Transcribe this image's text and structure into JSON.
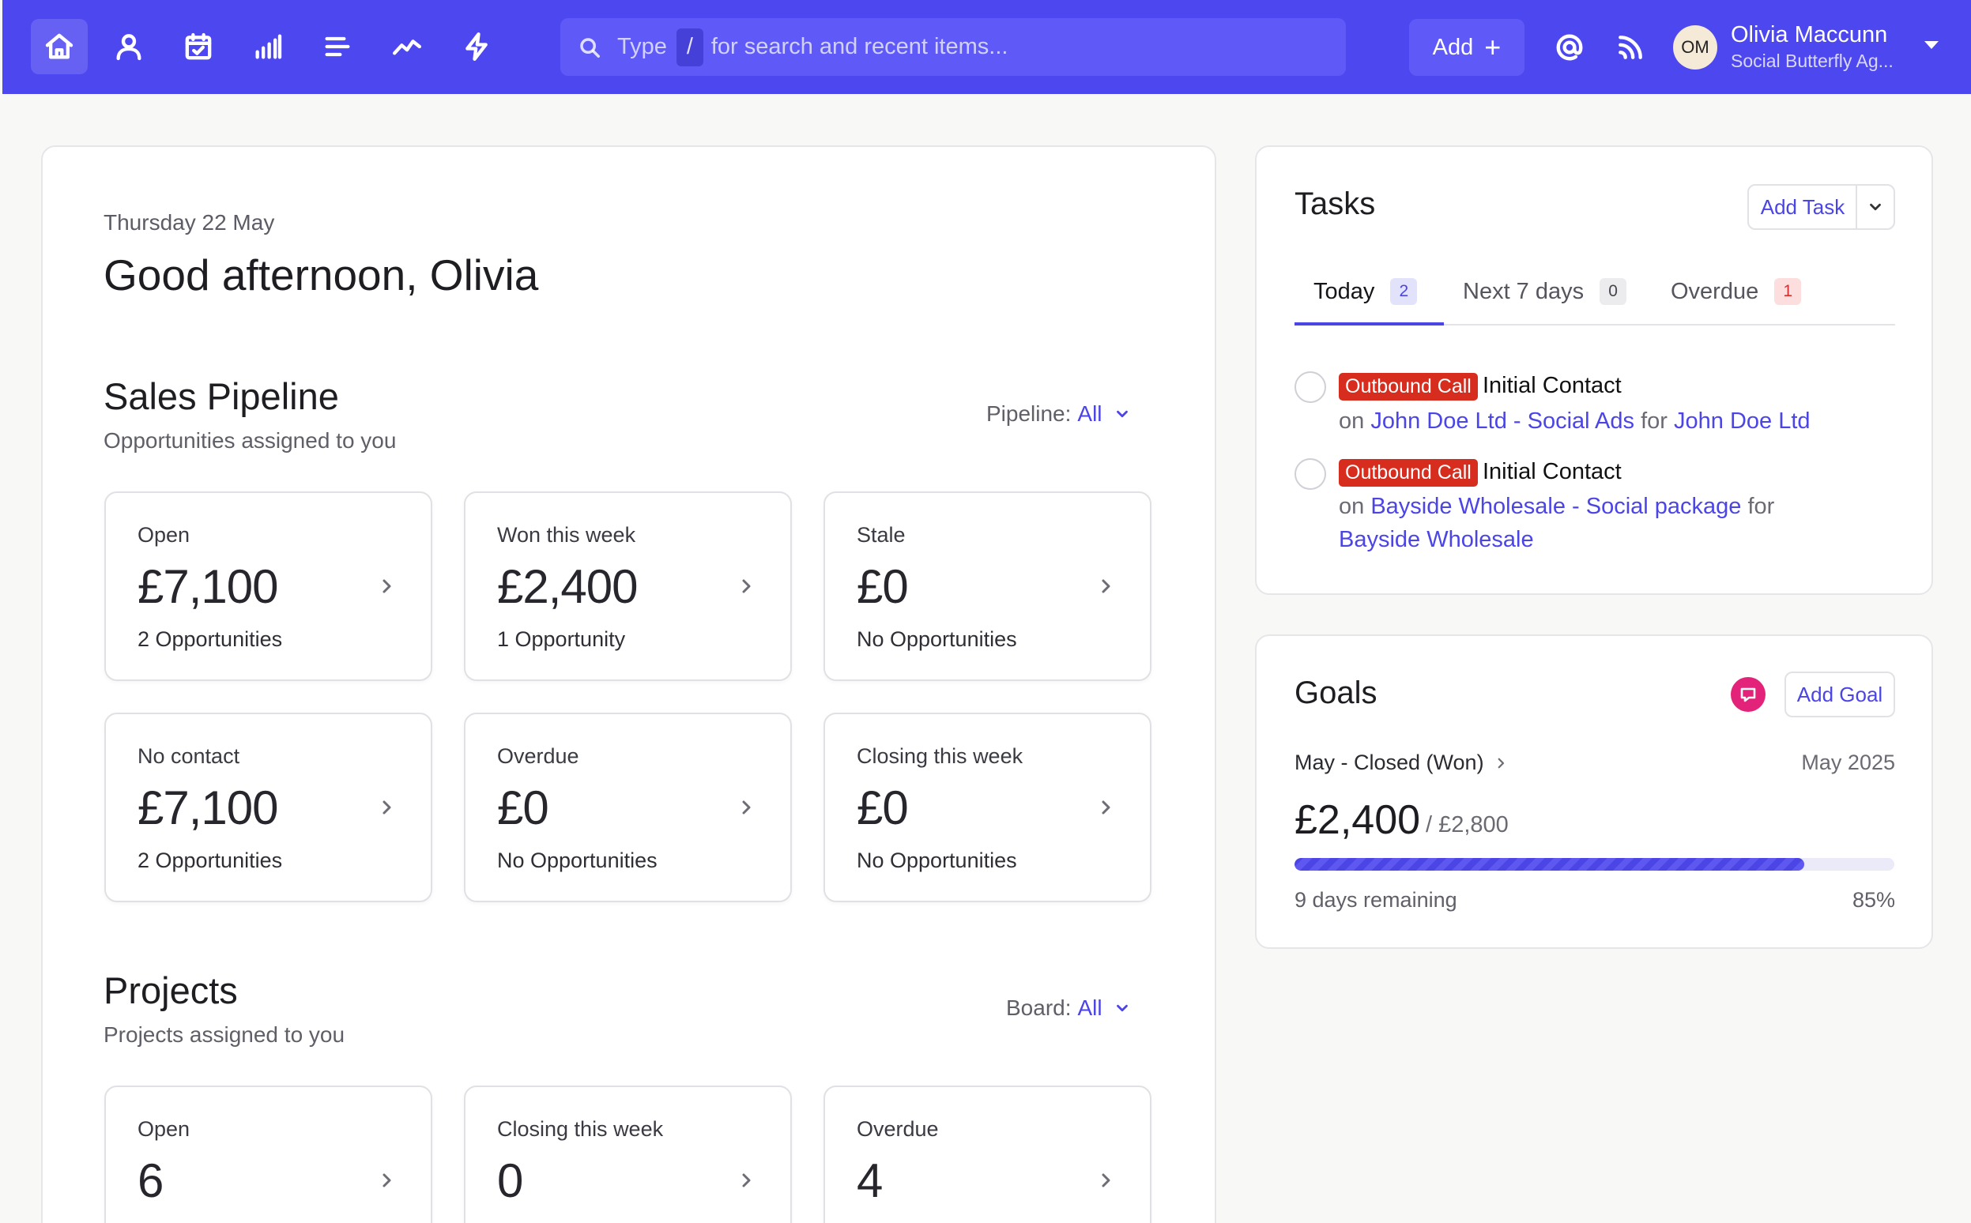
{
  "search": {
    "prefix": "Type",
    "key": "/",
    "placeholder": "for search and recent items..."
  },
  "header": {
    "add_label": "Add",
    "user": {
      "initials": "OM",
      "name": "Olivia Maccunn",
      "org": "Social Butterfly Ag..."
    }
  },
  "nav": {
    "icons": [
      "home-icon",
      "contacts-icon",
      "calendar-icon",
      "reports-icon",
      "list-icon",
      "activity-icon",
      "automation-icon"
    ]
  },
  "dashboard": {
    "date": "Thursday 22 May",
    "greeting": "Good afternoon, Olivia",
    "sales": {
      "title": "Sales Pipeline",
      "subtitle": "Opportunities assigned to you",
      "filter_label": "Pipeline:",
      "filter_value": "All",
      "stats": [
        {
          "label": "Open",
          "value": "£7,100",
          "sub": "2 Opportunities"
        },
        {
          "label": "Won this week",
          "value": "£2,400",
          "sub": "1 Opportunity"
        },
        {
          "label": "Stale",
          "value": "£0",
          "sub": "No Opportunities"
        },
        {
          "label": "No contact",
          "value": "£7,100",
          "sub": "2 Opportunities"
        },
        {
          "label": "Overdue",
          "value": "£0",
          "sub": "No Opportunities"
        },
        {
          "label": "Closing this week",
          "value": "£0",
          "sub": "No Opportunities"
        }
      ]
    },
    "projects": {
      "title": "Projects",
      "subtitle": "Projects assigned to you",
      "filter_label": "Board:",
      "filter_value": "All",
      "stats": [
        {
          "label": "Open",
          "value": "6"
        },
        {
          "label": "Closing this week",
          "value": "0"
        },
        {
          "label": "Overdue",
          "value": "4"
        }
      ]
    }
  },
  "tasks": {
    "title": "Tasks",
    "add_label": "Add Task",
    "tabs": [
      {
        "label": "Today",
        "count": "2"
      },
      {
        "label": "Next 7 days",
        "count": "0"
      },
      {
        "label": "Overdue",
        "count": "1"
      }
    ],
    "items": [
      {
        "type": "Outbound Call",
        "name": "Initial Contact",
        "on": "on",
        "deal": "John Doe Ltd - Social Ads",
        "for": "for",
        "company": "John Doe Ltd"
      },
      {
        "type": "Outbound Call",
        "name": "Initial Contact",
        "on": "on",
        "deal": "Bayside Wholesale - Social package",
        "for": "for",
        "company": "Bayside Wholesale"
      }
    ]
  },
  "goals": {
    "title": "Goals",
    "add_label": "Add Goal",
    "name": "May - Closed (Won)",
    "period": "May 2025",
    "amount": "£2,400",
    "target": "/ £2,800",
    "remaining": "9 days remaining",
    "percent_label": "85%",
    "progress": 0.85
  },
  "colors": {
    "brand": "#4d47f0",
    "accent": "#4b45e6",
    "task_type": "#d72d1e",
    "goal_icon": "#e3227a"
  }
}
